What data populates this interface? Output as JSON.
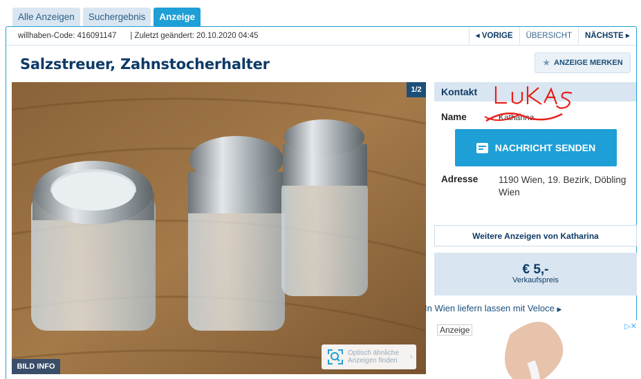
{
  "tabs": [
    {
      "label": "Alle Anzeigen",
      "active": false
    },
    {
      "label": "Suchergebnis",
      "active": false
    },
    {
      "label": "Anzeige",
      "active": true
    }
  ],
  "infobar": {
    "code": "willhaben-Code: 416091147",
    "changed": "| Zuletzt geändert: 20.10.2020 04:45",
    "prev": "VORIGE",
    "overview": "ÜBERSICHT",
    "next": "NÄCHSTE"
  },
  "listing": {
    "title": "Salzstreuer, Zahnstocherhalter",
    "save_label": "ANZEIGE MERKEN"
  },
  "image": {
    "counter": "1/2",
    "bild_info": "BILD INFO",
    "similar_line1": "Optisch ähnliche",
    "similar_line2": "Anzeigen finden"
  },
  "contact": {
    "heading": "Kontakt",
    "name_label": "Name",
    "name_value": "Katharina",
    "handwritten": "LUKAS",
    "send_label": "NACHRICHT SENDEN",
    "address_label": "Adresse",
    "address_line1": "1190 Wien, 19. Bezirk, Döbling",
    "address_line2": "Wien"
  },
  "more_ads": "Weitere Anzeigen von Katharina",
  "price": {
    "amount": "€ 5,-",
    "label": "Verkaufspreis"
  },
  "delivery": "In Wien liefern lassen mit Veloce",
  "ad": {
    "label": "Anzeige",
    "choices": "▷✕"
  },
  "colors": {
    "accent": "#1e9fd6",
    "navy": "#0d3a66",
    "light_panel": "#d9e6f1"
  }
}
